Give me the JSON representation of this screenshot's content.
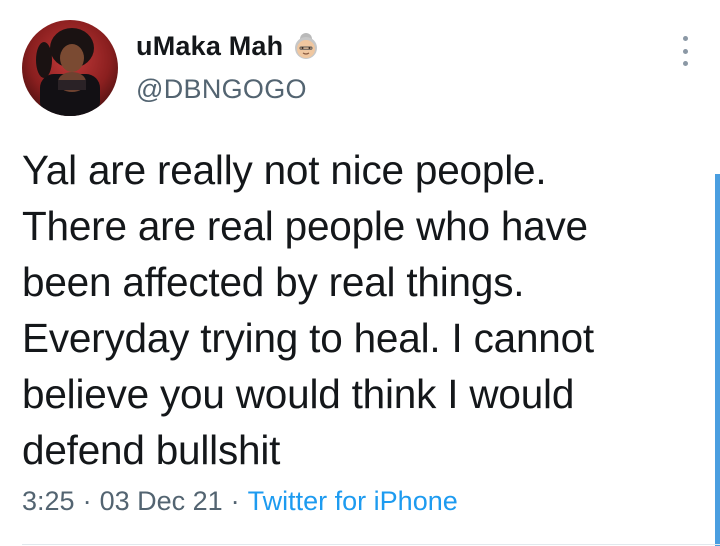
{
  "tweet": {
    "display_name": "uMaka Mah",
    "name_emoji": "older-woman-emoji",
    "handle": "@DBNGOGO",
    "text": "Yal are really not nice people.\nThere are real people who have\nbeen affected by real things.\nEveryday trying to heal. I cannot\nbelieve you would think I would\ndefend bullshit",
    "time": "3:25",
    "date": "03 Dec 21",
    "source": "Twitter for iPhone",
    "separator": "·"
  },
  "icons": {
    "more": "more-options-icon"
  },
  "colors": {
    "link": "#1d9bf0",
    "secondary_text": "#536471",
    "primary_text": "#14171a",
    "scrollbar": "#4a9ee0"
  }
}
